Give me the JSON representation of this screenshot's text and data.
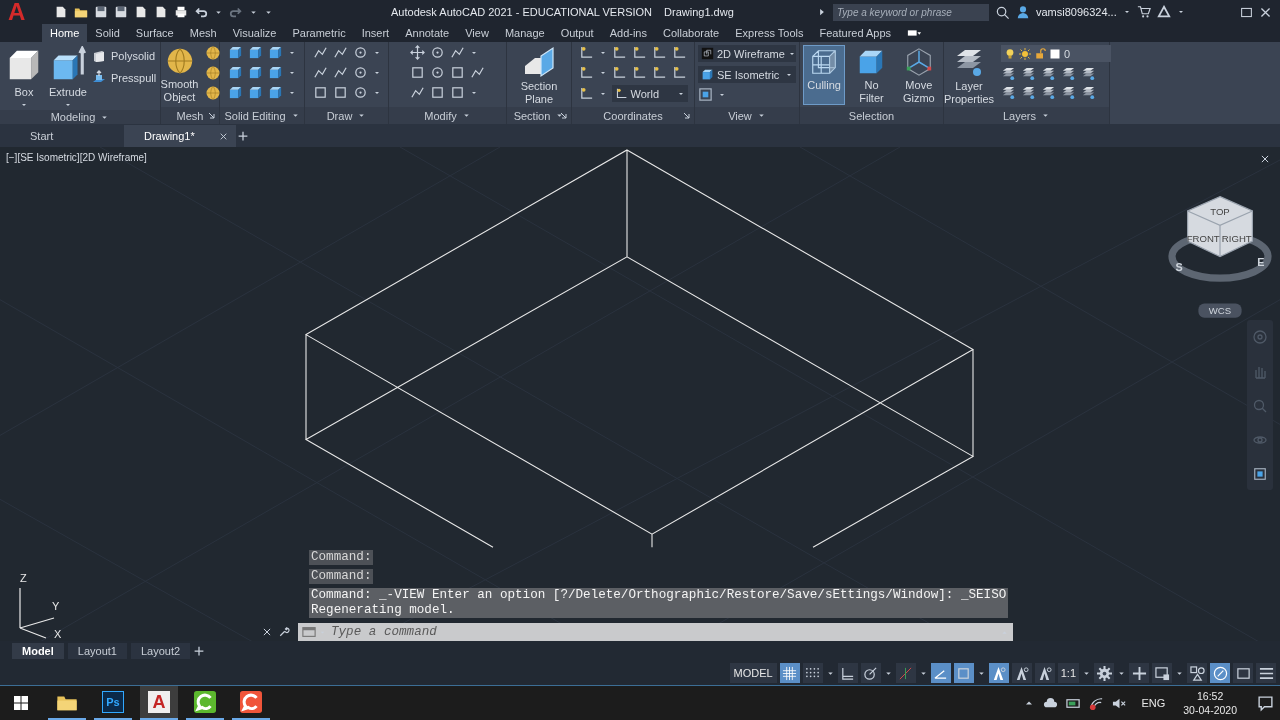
{
  "title_bar": {
    "logo": "A",
    "title": "Autodesk AutoCAD 2021 - EDUCATIONAL VERSION",
    "file": "Drawing1.dwg",
    "search": {
      "placeholder": "Type a keyword or phrase"
    },
    "user": "vamsi8096324..."
  },
  "ribbon_tabs": [
    {
      "label": "Home",
      "selected": true
    },
    {
      "label": "Solid",
      "selected": false
    },
    {
      "label": "Surface",
      "selected": false
    },
    {
      "label": "Mesh",
      "selected": false
    },
    {
      "label": "Visualize",
      "selected": false
    },
    {
      "label": "Parametric",
      "selected": false
    },
    {
      "label": "Insert",
      "selected": false
    },
    {
      "label": "Annotate",
      "selected": false
    },
    {
      "label": "View",
      "selected": false
    },
    {
      "label": "Manage",
      "selected": false
    },
    {
      "label": "Output",
      "selected": false
    },
    {
      "label": "Add-ins",
      "selected": false
    },
    {
      "label": "Collaborate",
      "selected": false
    },
    {
      "label": "Express Tools",
      "selected": false
    },
    {
      "label": "Featured Apps",
      "selected": false
    }
  ],
  "ribbon_panels": [
    {
      "kind": "modeling",
      "title": "Modeling",
      "expandable": true,
      "launcher": false,
      "buttons": [
        "Box",
        "Extrude"
      ],
      "small_buttons": [
        "Polysolid",
        "Presspull"
      ]
    },
    {
      "kind": "mesh",
      "title": "Mesh",
      "expandable": false,
      "launcher": true,
      "buttons": [
        "Smooth Object"
      ]
    },
    {
      "kind": "solid-editing",
      "title": "Solid Editing",
      "expandable": true,
      "launcher": false
    },
    {
      "kind": "draw",
      "title": "Draw",
      "expandable": true,
      "launcher": false
    },
    {
      "kind": "modify",
      "title": "Modify",
      "expandable": true,
      "launcher": false
    },
    {
      "kind": "section",
      "title": "Section",
      "expandable": true,
      "launcher": true,
      "buttons": [
        "Section Plane"
      ]
    },
    {
      "kind": "coordinates",
      "title": "Coordinates",
      "expandable": false,
      "launcher": true,
      "ucs": "World"
    },
    {
      "kind": "view",
      "title": "View",
      "expandable": true,
      "launcher": false,
      "visual_style": "2D Wireframe",
      "view": "SE Isometric"
    },
    {
      "kind": "selection",
      "title": "Selection",
      "expandable": false,
      "launcher": false,
      "buttons": [
        {
          "label": "Culling",
          "selected": true
        },
        {
          "label": "No Filter",
          "selected": false
        },
        {
          "label": "Move Gizmo",
          "selected": false
        }
      ]
    },
    {
      "kind": "layers",
      "title": "Layers",
      "expandable": true,
      "launcher": false,
      "buttons": [
        "Layer Properties"
      ],
      "current_layer": "0"
    }
  ],
  "file_tabs": [
    {
      "label": "Start",
      "selected": false
    },
    {
      "label": "Drawing1*",
      "selected": true
    }
  ],
  "viewport": {
    "label": "[−][SE Isometric][2D Wireframe]",
    "viewcube": {
      "faces": [
        "TOP",
        "FRONT",
        "RIGHT"
      ],
      "compass": [
        "S",
        "E"
      ],
      "ucs": "WCS"
    },
    "ucs_icon": {
      "axes": [
        "Z",
        "Y",
        "X"
      ]
    }
  },
  "command_line": {
    "history": [
      "Command:",
      "Command:"
    ],
    "last": [
      "Command: _-VIEW Enter an option [?/Delete/Orthographic/Restore/Save/sEttings/Window]: _SEISO",
      "Regenerating model."
    ],
    "placeholder": "Type a command"
  },
  "layout_tabs": [
    {
      "label": "Model",
      "selected": true
    },
    {
      "label": "Layout1",
      "selected": false
    },
    {
      "label": "Layout2",
      "selected": false
    }
  ],
  "status_bar": {
    "space": "MODEL",
    "scale": "1:1",
    "toggles": [
      {
        "kind": "grid",
        "on": true
      },
      {
        "kind": "snap",
        "on": false
      },
      {
        "kind": "ortho",
        "on": false
      },
      {
        "kind": "polar",
        "on": false
      },
      {
        "kind": "otrack",
        "on": false
      },
      {
        "kind": "isodraft",
        "on": true
      },
      {
        "kind": "osnap",
        "on": true
      },
      {
        "kind": "annovis",
        "on": true
      },
      {
        "kind": "autoscale",
        "on": false
      },
      {
        "kind": "annomon",
        "on": false
      }
    ],
    "tools": [
      {
        "kind": "gear",
        "on": false
      },
      {
        "kind": "plus",
        "on": false
      },
      {
        "kind": "workspace",
        "on": false
      },
      {
        "kind": "isolate",
        "on": false
      },
      {
        "kind": "accel",
        "on": true
      },
      {
        "kind": "fullscreen",
        "on": false
      },
      {
        "kind": "menu",
        "on": false
      }
    ]
  },
  "taskbar": {
    "apps": [
      {
        "kind": "explorer",
        "selected": false
      },
      {
        "kind": "photoshop",
        "label": "Ps",
        "selected": false
      },
      {
        "kind": "autocad",
        "label": "A",
        "selected": true
      },
      {
        "kind": "camtasia-green",
        "selected": false
      },
      {
        "kind": "camtasia-red",
        "selected": false
      }
    ],
    "language": "ENG",
    "time": "16:52",
    "date": "30-04-2020"
  }
}
